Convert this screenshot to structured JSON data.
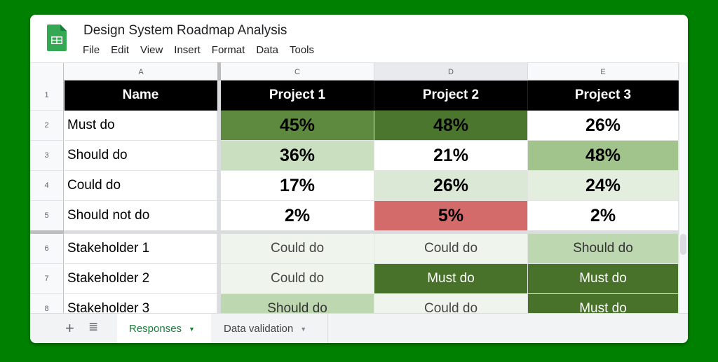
{
  "app": {
    "title": "Design System Roadmap Analysis",
    "logo_icon": "google-sheets-icon",
    "menu": [
      "File",
      "Edit",
      "View",
      "Insert",
      "Format",
      "Data",
      "Tools"
    ]
  },
  "grid": {
    "column_headers": [
      "A",
      "C",
      "D",
      "E"
    ],
    "selected_column": "D",
    "row_numbers": [
      "1",
      "2",
      "3",
      "4",
      "5",
      "6",
      "7",
      "8"
    ],
    "header_row": [
      "Name",
      "Project 1",
      "Project 2",
      "Project 3"
    ],
    "summary_rows": [
      {
        "label": "Must do",
        "values": [
          "45%",
          "48%",
          "26%"
        ],
        "colors": [
          "#5e8a3f",
          "#4b762d",
          "#ffffff"
        ],
        "text_colors": [
          "#000000",
          "#000000",
          "#000000"
        ]
      },
      {
        "label": "Should do",
        "values": [
          "36%",
          "21%",
          "48%"
        ],
        "colors": [
          "#c9dfc0",
          "#ffffff",
          "#a0c48c"
        ],
        "text_colors": [
          "#000000",
          "#000000",
          "#000000"
        ]
      },
      {
        "label": "Could do",
        "values": [
          "17%",
          "26%",
          "24%"
        ],
        "colors": [
          "#ffffff",
          "#dbe8d5",
          "#e3eedf"
        ],
        "text_colors": [
          "#000000",
          "#000000",
          "#000000"
        ]
      },
      {
        "label": "Should not do",
        "values": [
          "2%",
          "5%",
          "2%"
        ],
        "colors": [
          "#ffffff",
          "#d46b6b",
          "#ffffff"
        ],
        "text_colors": [
          "#000000",
          "#000000",
          "#000000"
        ]
      }
    ],
    "stakeholder_rows": [
      {
        "label": "Stakeholder 1",
        "values": [
          "Could do",
          "Could do",
          "Should do"
        ],
        "colors": [
          "#eff5ec",
          "#eff5ec",
          "#bdd7b0"
        ],
        "text_colors": [
          "#444444",
          "#444444",
          "#333333"
        ]
      },
      {
        "label": "Stakeholder 2",
        "values": [
          "Could do",
          "Must do",
          "Must do"
        ],
        "colors": [
          "#eff5ec",
          "#487229",
          "#487229"
        ],
        "text_colors": [
          "#444444",
          "#ffffff",
          "#ffffff"
        ]
      },
      {
        "label": "Stakeholder 3",
        "values": [
          "Should do",
          "Could do",
          "Must do"
        ],
        "colors": [
          "#bdd7b0",
          "#eff5ec",
          "#487229"
        ],
        "text_colors": [
          "#333333",
          "#444444",
          "#ffffff"
        ]
      }
    ]
  },
  "bottom_bar": {
    "add_sheet_icon": "+",
    "all_sheets_icon": "≣",
    "tabs": [
      {
        "label": "Responses",
        "active": true
      },
      {
        "label": "Data validation",
        "active": false
      }
    ],
    "caret": "▼"
  }
}
